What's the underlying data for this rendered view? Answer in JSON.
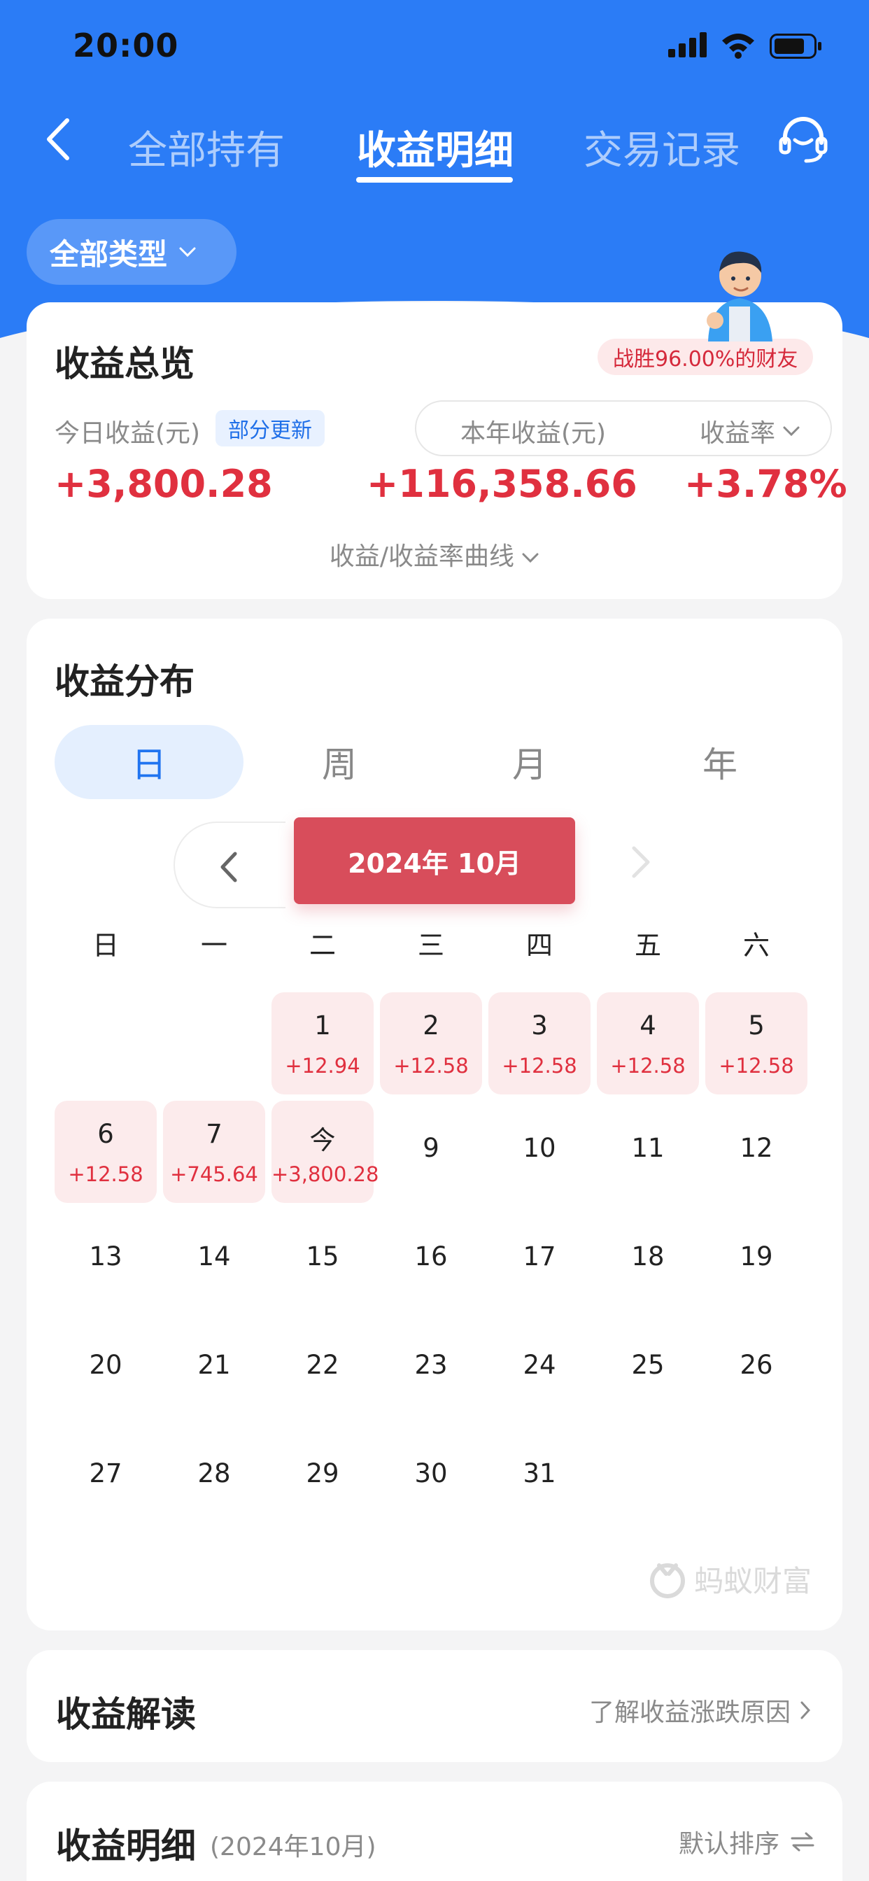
{
  "status_bar": {
    "time": "20:00"
  },
  "nav": {
    "tabs": [
      {
        "label": "全部持有",
        "active": false
      },
      {
        "label": "收益明细",
        "active": true
      },
      {
        "label": "交易记录",
        "active": false
      }
    ]
  },
  "filter": {
    "label": "全部类型"
  },
  "overview": {
    "title": "收益总览",
    "rank_badge": "战胜96.00%的财友",
    "today_label": "今日收益(元)",
    "partial_badge": "部分更新",
    "year_label": "本年收益(元)",
    "rate_label": "收益率",
    "today_value": "+3,800.28",
    "year_value": "+116,358.66",
    "rate_value": "+3.78%",
    "curve_link": "收益/收益率曲线"
  },
  "distribution": {
    "title": "收益分布",
    "period_tabs": [
      "日",
      "周",
      "月",
      "年"
    ],
    "active_period": "日",
    "month_label": "2024年 10月",
    "weekdays": [
      "日",
      "一",
      "二",
      "三",
      "四",
      "五",
      "六"
    ],
    "days": [
      {
        "label": "1",
        "income": "+12.94"
      },
      {
        "label": "2",
        "income": "+12.58"
      },
      {
        "label": "3",
        "income": "+12.58"
      },
      {
        "label": "4",
        "income": "+12.58"
      },
      {
        "label": "5",
        "income": "+12.58"
      },
      {
        "label": "6",
        "income": "+12.58"
      },
      {
        "label": "7",
        "income": "+745.64"
      },
      {
        "label": "今",
        "income": "+3,800.28"
      },
      {
        "label": "9",
        "income": ""
      },
      {
        "label": "10",
        "income": ""
      },
      {
        "label": "11",
        "income": ""
      },
      {
        "label": "12",
        "income": ""
      },
      {
        "label": "13",
        "income": ""
      },
      {
        "label": "14",
        "income": ""
      },
      {
        "label": "15",
        "income": ""
      },
      {
        "label": "16",
        "income": ""
      },
      {
        "label": "17",
        "income": ""
      },
      {
        "label": "18",
        "income": ""
      },
      {
        "label": "19",
        "income": ""
      },
      {
        "label": "20",
        "income": ""
      },
      {
        "label": "21",
        "income": ""
      },
      {
        "label": "22",
        "income": ""
      },
      {
        "label": "23",
        "income": ""
      },
      {
        "label": "24",
        "income": ""
      },
      {
        "label": "25",
        "income": ""
      },
      {
        "label": "26",
        "income": ""
      },
      {
        "label": "27",
        "income": ""
      },
      {
        "label": "28",
        "income": ""
      },
      {
        "label": "29",
        "income": ""
      },
      {
        "label": "30",
        "income": ""
      },
      {
        "label": "31",
        "income": ""
      }
    ],
    "watermark": "蚂蚁财富"
  },
  "interpretation": {
    "title": "收益解读",
    "link": "了解收益涨跌原因"
  },
  "detail": {
    "title": "收益明细",
    "subtitle": "(2024年10月)",
    "sort_label": "默认排序"
  },
  "colors": {
    "brand_blue": "#2b7cf6",
    "income_red": "#e0303f",
    "pill_red": "#d84d5b"
  }
}
